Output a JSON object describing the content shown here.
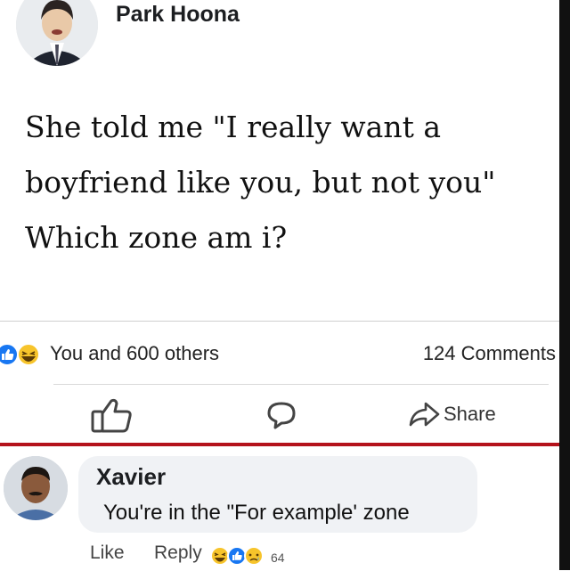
{
  "post": {
    "author": "Park Hoona",
    "text_lines": [
      "She told me \"I really want a",
      "boyfriend like you, but not you\"",
      "Which zone am i?"
    ],
    "reactions_summary": "You and 600 others",
    "comments_count": "124 Comments",
    "share_label": "Share",
    "reaction_types": [
      "like-icon",
      "haha-icon"
    ]
  },
  "comment": {
    "author": "Xavier",
    "text": "You're in the \"For example' zone",
    "like_label": "Like",
    "reply_label": "Reply",
    "reaction_count": "64",
    "reaction_types": [
      "haha-icon",
      "like-icon",
      "sad-icon"
    ]
  },
  "colors": {
    "accent_red": "#b4121b",
    "like_blue": "#1877f2",
    "haha_yellow": "#f7c42b",
    "bubble_gray": "#f0f2f5"
  }
}
